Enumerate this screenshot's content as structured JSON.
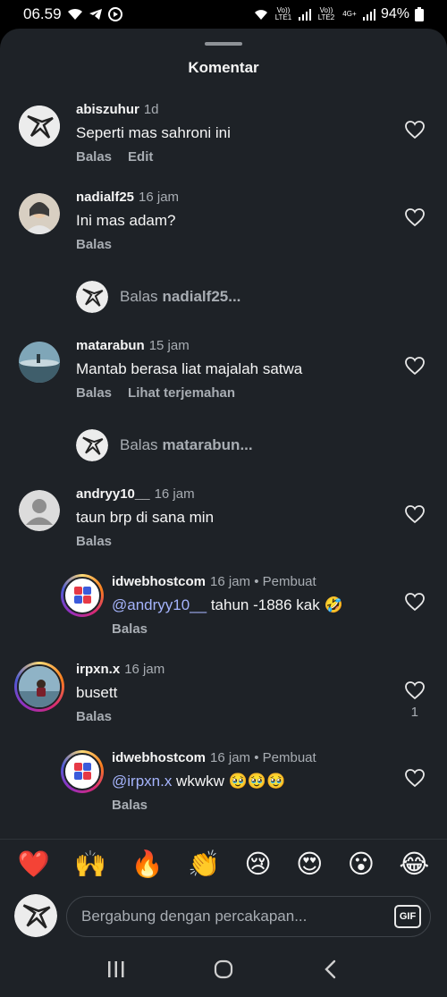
{
  "status_bar": {
    "time": "06.59",
    "sim1_label": "Vo)) LTE1",
    "sim2_label": "Vo)) LTE2",
    "network": "4G+",
    "battery": "94%"
  },
  "sheet": {
    "title": "Komentar"
  },
  "comments": [
    {
      "username": "abiszuhur",
      "time": "1d",
      "text": "Seperti mas sahroni ini",
      "actions": [
        "Balas",
        "Edit"
      ]
    },
    {
      "username": "nadialf25",
      "time": "16 jam",
      "text": "Ini mas adam?",
      "actions": [
        "Balas"
      ],
      "reply_prompt": {
        "prefix": "Balas",
        "who": "nadialf25..."
      }
    },
    {
      "username": "matarabun",
      "time": "15 jam",
      "text": "Mantab berasa liat majalah satwa",
      "actions": [
        "Balas",
        "Lihat terjemahan"
      ],
      "reply_prompt": {
        "prefix": "Balas",
        "who": "matarabun..."
      }
    },
    {
      "username": "andryy10__",
      "time": "16 jam",
      "text": "taun brp di sana min",
      "actions": [
        "Balas"
      ]
    },
    {
      "username": "idwebhostcom",
      "time": "16 jam",
      "creator": "Pembuat",
      "mention": "@andryy10__",
      "text": " tahun -1886 kak 🤣",
      "actions": [
        "Balas"
      ]
    },
    {
      "username": "irpxn.x",
      "time": "16 jam",
      "text": "busett",
      "actions": [
        "Balas"
      ],
      "likes": "1"
    },
    {
      "username": "idwebhostcom",
      "time": "16 jam",
      "creator": "Pembuat",
      "mention": "@irpxn.x",
      "text": " wkwkw 🥹🥹🥹",
      "actions": [
        "Balas"
      ]
    }
  ],
  "separator": "•",
  "quick_emojis": [
    "❤️",
    "🙌",
    "🔥",
    "👏",
    "😢",
    "😍",
    "😮",
    "😂"
  ],
  "composer": {
    "placeholder": "Bergabung dengan percakapan...",
    "gif_label": "GIF"
  },
  "icons": {
    "heart": "heart-outline-icon",
    "recents": "recent-apps-icon",
    "home": "home-icon",
    "back": "back-icon"
  },
  "colors": {
    "sheet_bg": "#1e2227",
    "text": "#f5f5f5",
    "secondary": "#a8adb3",
    "mention": "#a5b4fc",
    "story_ring": "#d62976"
  }
}
